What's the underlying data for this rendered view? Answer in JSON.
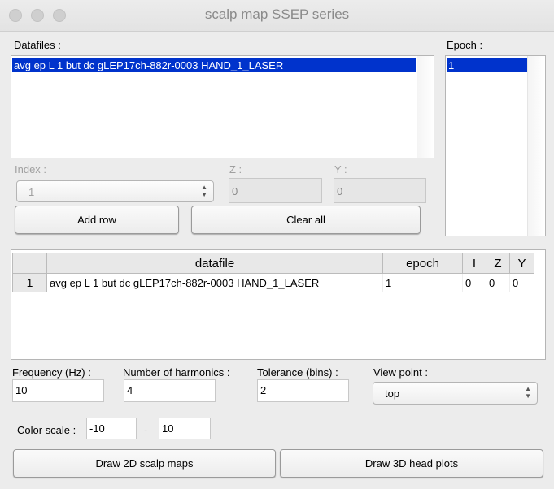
{
  "window": {
    "title": "scalp map SSEP series"
  },
  "datafiles": {
    "label": "Datafiles :",
    "items": [
      "avg ep L  1 but dc gLEP17ch-882r-0003 HAND_1_LASER"
    ]
  },
  "epoch": {
    "label": "Epoch :",
    "items": [
      "1"
    ]
  },
  "index": {
    "label": "Index :",
    "value": "1"
  },
  "z": {
    "label": "Z :",
    "value": "0"
  },
  "y": {
    "label": "Y :",
    "value": "0"
  },
  "buttons": {
    "add_row": "Add row",
    "clear_all": "Clear all",
    "draw_2d": "Draw 2D scalp maps",
    "draw_3d": "Draw 3D head plots"
  },
  "table": {
    "columns": [
      "datafile",
      "epoch",
      "I",
      "Z",
      "Y"
    ],
    "rows": [
      {
        "num": "1",
        "cells": [
          "avg ep L  1 but dc gLEP17ch-882r-0003 HAND_1_LASER",
          "1",
          "0",
          "0",
          "0"
        ]
      }
    ]
  },
  "frequency": {
    "label": "Frequency (Hz) :",
    "value": "10"
  },
  "harmonics": {
    "label": "Number of harmonics :",
    "value": "4"
  },
  "tolerance": {
    "label": "Tolerance (bins) :",
    "value": "2"
  },
  "viewpoint": {
    "label": "View point :",
    "value": "top"
  },
  "colorscale": {
    "label": "Color scale :",
    "min": "-10",
    "sep": "-",
    "max": "10"
  }
}
